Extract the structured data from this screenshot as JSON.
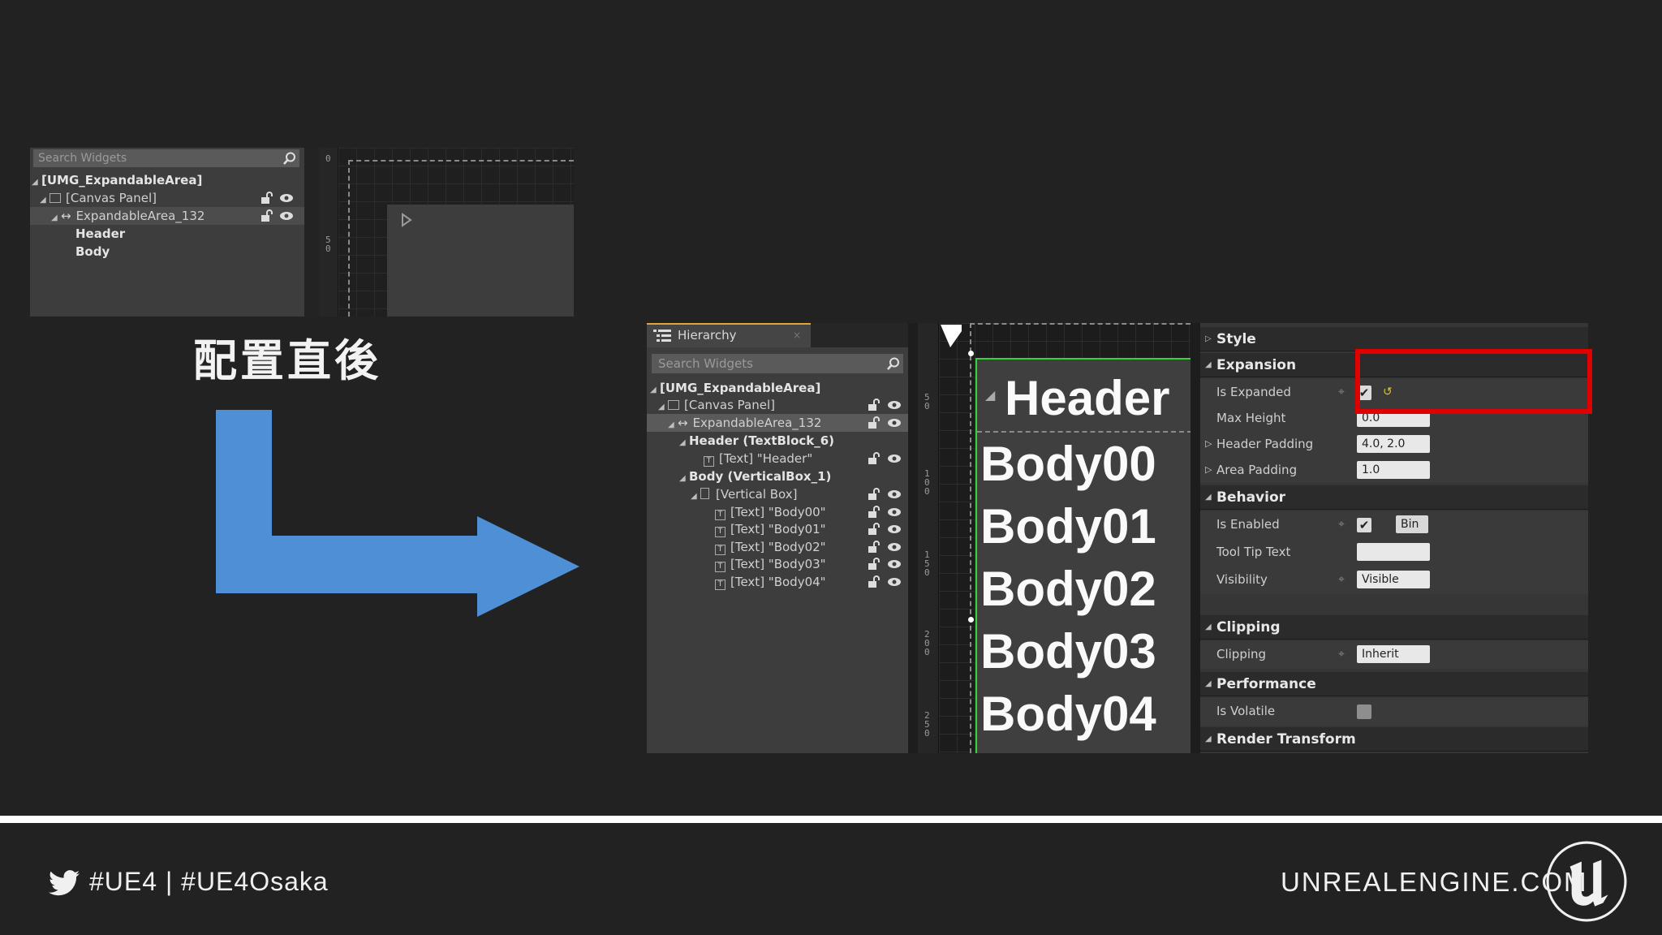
{
  "before_panel": {
    "search_placeholder": "Search Widgets",
    "tree": [
      {
        "label": "[UMG_ExpandableArea]"
      },
      {
        "label": "[Canvas Panel]"
      },
      {
        "label": "ExpandableArea_132"
      },
      {
        "label": "Header"
      },
      {
        "label": "Body"
      }
    ],
    "ruler_top": "0",
    "ruler_mid": "5\n0"
  },
  "caption": "配置直後",
  "hierarchy": {
    "tab_label": "Hierarchy",
    "tab_close": "×",
    "search_placeholder": "Search Widgets",
    "tree": [
      {
        "label": "[UMG_ExpandableArea]"
      },
      {
        "label": "[Canvas Panel]"
      },
      {
        "label": "ExpandableArea_132"
      },
      {
        "label": "Header (TextBlock_6)"
      },
      {
        "label": "[Text] \"Header\""
      },
      {
        "label": "Body (VerticalBox_1)"
      },
      {
        "label": "[Vertical Box]"
      },
      {
        "label": "[Text] \"Body00\""
      },
      {
        "label": "[Text] \"Body01\""
      },
      {
        "label": "[Text] \"Body02\""
      },
      {
        "label": "[Text] \"Body03\""
      },
      {
        "label": "[Text] \"Body04\""
      }
    ]
  },
  "canvas": {
    "header_text": "Header",
    "body_lines": [
      "Body00",
      "Body01",
      "Body02",
      "Body03",
      "Body04"
    ],
    "ruler": [
      "5\n0",
      "1\n0\n0",
      "1\n5\n0",
      "2\n0\n0",
      "2\n5\n0"
    ]
  },
  "details": {
    "style": "Style",
    "expansion": "Expansion",
    "is_expanded": "Is Expanded",
    "max_height": "Max Height",
    "max_height_value": "0.0",
    "header_padding": "Header Padding",
    "header_padding_value": "4.0, 2.0",
    "area_padding": "Area Padding",
    "area_padding_value": "1.0",
    "behavior": "Behavior",
    "is_enabled": "Is Enabled",
    "bind_label": "Bin",
    "tool_tip_text": "Tool Tip Text",
    "visibility": "Visibility",
    "visibility_value": "Visible",
    "clipping_cat": "Clipping",
    "clipping": "Clipping",
    "clipping_value": "Inherit",
    "performance": "Performance",
    "is_volatile": "Is Volatile",
    "render_transform": "Render Transform",
    "highlight_color": "#e00000"
  },
  "footer": {
    "hashtags": "#UE4 | #UE4Osaka",
    "site": "UNREALENGINE.COM"
  },
  "colors": {
    "arrow": "#4f8fd6",
    "selection": "#38d23a",
    "tab_accent": "#e2a23a"
  }
}
